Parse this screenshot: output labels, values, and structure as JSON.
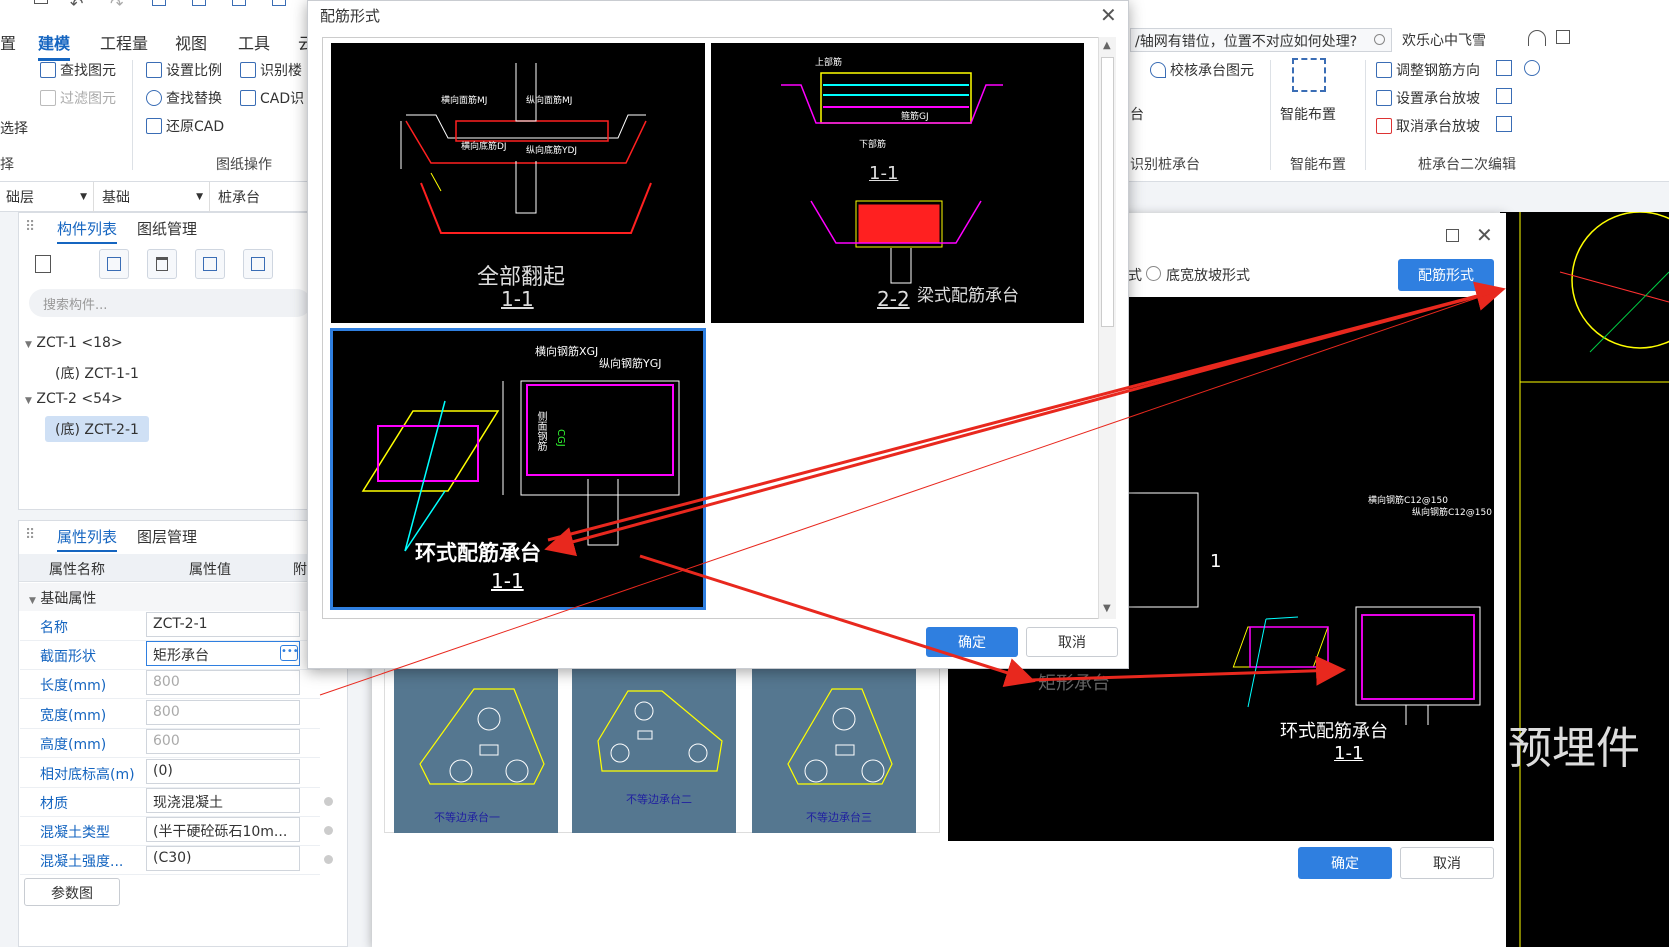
{
  "ribbon": {
    "tabs": [
      "置",
      "建模",
      "工程量",
      "视图",
      "工具",
      "云"
    ],
    "active_tab": "建模",
    "buttons": {
      "find_element": "查找图元",
      "filter_element": "过滤图元",
      "set_scale": "设置比例",
      "find_replace": "查找替换",
      "restore_cad": "还原CAD",
      "identify_floor": "识别楼",
      "cad_identify": "CAD识",
      "check_cap": "校核承台图元",
      "smart_layout": "智能布置",
      "adjust_rebar": "调整钢筋方向",
      "set_slope": "设置承台放坡",
      "cancel_slope": "取消承台放坡"
    },
    "groups": {
      "select": "择",
      "drawing_ops": "图纸操作",
      "identify_cap": "识别桩承台",
      "smart_layout": "智能布置",
      "secondary_edit": "桩承台二次编辑",
      "partial_select": "选择",
      "partial_layer": "台"
    },
    "search_text": "/轴网有错位，位置不对应如何处理?",
    "user": "欢乐心中飞雪"
  },
  "selectors": [
    "础层",
    "基础",
    "桩承台"
  ],
  "component_panel": {
    "tabs": [
      "构件列表",
      "图纸管理"
    ],
    "search_placeholder": "搜索构件...",
    "tree": [
      {
        "label": "ZCT-1 <18>",
        "child": "(底) ZCT-1-1"
      },
      {
        "label": "ZCT-2 <54>",
        "child": "(底) ZCT-2-1"
      }
    ]
  },
  "property_panel": {
    "tabs": [
      "属性列表",
      "图层管理"
    ],
    "headers": [
      "属性名称",
      "属性值",
      "附"
    ],
    "section": "基础属性",
    "rows": [
      {
        "name": "名称",
        "value": "ZCT-2-1"
      },
      {
        "name": "截面形状",
        "value": "矩形承台"
      },
      {
        "name": "长度(mm)",
        "value": "800"
      },
      {
        "name": "宽度(mm)",
        "value": "800"
      },
      {
        "name": "高度(mm)",
        "value": "600"
      },
      {
        "name": "相对底标高(m)",
        "value": "(0)"
      },
      {
        "name": "材质",
        "value": "现浇混凝土"
      },
      {
        "name": "混凝土类型",
        "value": "(半干硬砼砾石10m..."
      },
      {
        "name": "混凝土强度...",
        "value": "(C30)"
      }
    ],
    "footer_button": "参数图"
  },
  "shape_dialog": {
    "radio_partial": "式",
    "radio_label": "底宽放坡形式",
    "rebar_form_button": "配筋形式",
    "ok": "确定",
    "cancel": "取消",
    "shapes": [
      "不等边承台一",
      "不等边承台二",
      "不等边承台三"
    ],
    "preview_title": "环式配筋承台",
    "preview_section": "1-1",
    "preview_labels": {
      "h_rebar": "横向钢筋C12@150",
      "v_rebar": "纵向钢筋C12@150"
    },
    "preview_dim": "1",
    "bg_label": "矩形承台",
    "bg_side_text": "预埋件"
  },
  "rebar_dialog": {
    "title": "配筋形式",
    "ok": "确定",
    "cancel": "取消",
    "options": [
      {
        "title": "全部翻起",
        "section": "1-1"
      },
      {
        "title": "梁式配筋承台",
        "section": "2-2",
        "section2": "1-1"
      },
      {
        "title": "环式配筋承台",
        "section": "1-1"
      }
    ],
    "annotations": {
      "h_face": "横向面筋MJ",
      "v_face": "纵向面筋MJ",
      "h_bottom": "横向底筋DJ",
      "v_bottom": "纵向底筋YDJ",
      "top": "上部筋",
      "stirrup": "箍筋GJ",
      "bottom": "下部筋",
      "h_rebar": "横向钢筋XGJ",
      "v_rebar": "纵向钢筋YGJ",
      "side": "侧面钢筋",
      "cgj": "CGJ"
    }
  },
  "colors": {
    "accent": "#2f7fe0",
    "arrow": "#e8281e",
    "cad_yellow": "#ffff00",
    "cad_magenta": "#ff00ff",
    "cad_cyan": "#00ffff",
    "cad_red": "#ff2020"
  }
}
